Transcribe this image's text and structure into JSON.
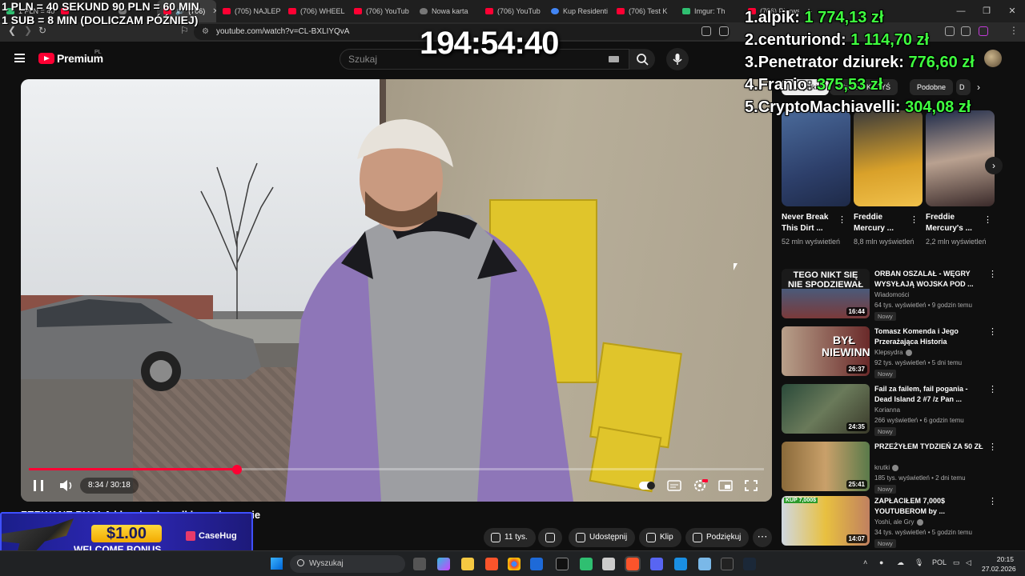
{
  "browser": {
    "tabs": [
      {
        "label": "1 PLN = 40",
        "active": false
      },
      {
        "label": "(706)",
        "active": true
      },
      {
        "label": "(705) NAJLEP",
        "active": false
      },
      {
        "label": "(706) WHEEL",
        "active": false
      },
      {
        "label": "(706) YouTub",
        "active": false
      },
      {
        "label": "Nowa karta",
        "active": false
      },
      {
        "label": "(706) YouTub",
        "active": false
      },
      {
        "label": "Kup Residenti",
        "active": false
      },
      {
        "label": "(706) Test K",
        "active": false
      },
      {
        "label": "Imgur: Th",
        "active": false
      },
      {
        "label": "(706) Pierwsz",
        "active": false
      }
    ],
    "new_tab": "+",
    "url": "youtube.com/watch?v=CL-BXLIYQvA"
  },
  "youtube": {
    "logo_text": "Premium",
    "logo_region": "PL",
    "search_placeholder": "Szukaj",
    "player": {
      "time": "8:34 / 30:18",
      "progress": 0.283
    },
    "video_title": "ZERWANE PUALA i bardzo brzydkie zachowanie",
    "actions": {
      "likes": "11 tys.",
      "share": "Udostępnij",
      "clip": "Klip",
      "thanks": "Podziękuj",
      "more": "⋯"
    },
    "chips": [
      "Wszystkie",
      "Z kanału KRZYŚ",
      "Podobne",
      "D"
    ],
    "shorts": [
      {
        "title": "Never Break This Dirt ...",
        "views": "52 mln wyświetleń"
      },
      {
        "title": "Freddie Mercury ...",
        "views": "8,8 mln wyświetleń"
      },
      {
        "title": "Freddie Mercury's ...",
        "views": "2,2 mln wyświetleń"
      }
    ],
    "recommendations": [
      {
        "title": "ORBAN OSZALAŁ - WĘGRY WYSYŁAJĄ WOJSKA POD ...",
        "channel": "Wiadomości",
        "meta": "64 tys. wyświetleń • 9 godzin temu",
        "badge": "Nowy",
        "duration": "16:44",
        "thumb_text": "TEGO NIKT SIĘ NIE SPODZIEWAŁ"
      },
      {
        "title": "Tomasz Komenda i Jego Przerażająca Historia",
        "channel": "Klepsydra",
        "meta": "92 tys. wyświetleń • 5 dni temu",
        "badge": "Nowy",
        "duration": "26:37",
        "thumb_text": "BYŁ NIEWINNY"
      },
      {
        "title": "Fail za failem, fail pogania - Dead Island 2 #7 /z Pan ...",
        "channel": "Korianna",
        "meta": "266 wyświetleń • 6 godzin temu",
        "badge": "Nowy",
        "duration": "24:35",
        "thumb_text": ""
      },
      {
        "title": "PRZEŻYŁEM TYDZIEŃ ZA 50 ZŁ",
        "channel": "krutki",
        "meta": "185 tys. wyświetleń • 2 dni temu",
        "badge": "Nowy",
        "duration": "25:41",
        "thumb_text": ""
      },
      {
        "title": "ZAPŁACIŁEM 7,000$ YOUTUBEROM by ...",
        "channel": "Yoshi, ale Gry",
        "meta": "34 tys. wyświetleń • 5 godzin temu",
        "badge": "Nowy",
        "duration": "14:07",
        "thumb_text": "KUP 7,000$"
      }
    ]
  },
  "overlay": {
    "rates_line1": "1 PLN = 40 SEKUND 90 PLN = 60 MIN",
    "rates_line2": "1 SUB = 8 MIN (DOLICZAM PÓŹNIEJ)",
    "timer": "194:54:40",
    "leaderboard": [
      {
        "rank": "1.",
        "name": "alpik:",
        "amount": "1 774,13 zł"
      },
      {
        "rank": "2.",
        "name": "centuriond:",
        "amount": "1 114,70 zł"
      },
      {
        "rank": "3.",
        "name": "Penetrator dziurek:",
        "amount": "776,60 zł"
      },
      {
        "rank": "4.",
        "name": "Franio:",
        "amount": "375,53 zł"
      },
      {
        "rank": "5.",
        "name": "CryptoMachiavelli:",
        "amount": "304,08 zł"
      }
    ],
    "ad": {
      "price": "$1.00",
      "bonus": "WELCOME BONUS",
      "brand": "CaseHug"
    }
  },
  "taskbar": {
    "search": "Wyszukaj",
    "lang": "POL",
    "time": "20:15",
    "date": "27.02.2026"
  }
}
